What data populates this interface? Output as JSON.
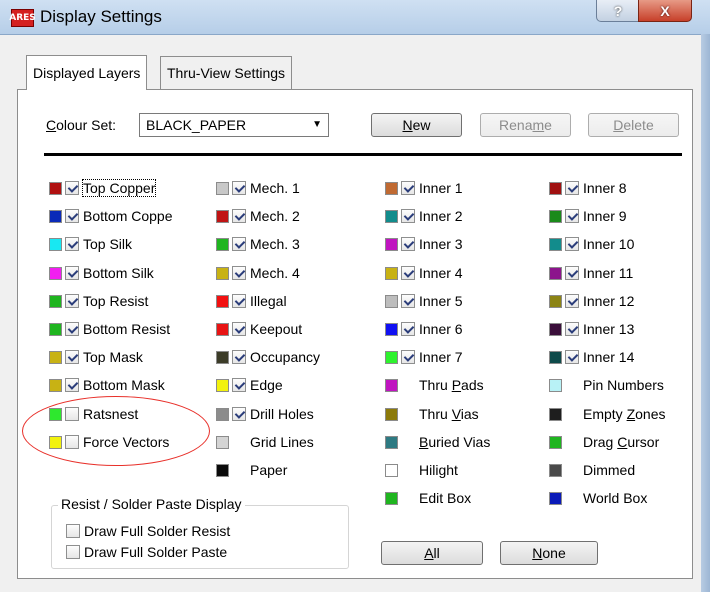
{
  "window": {
    "title": "Display Settings",
    "logo_text": "ARES",
    "help_label": "?",
    "close_label": "X"
  },
  "tabs": [
    {
      "label": "Displayed Layers",
      "active": true
    },
    {
      "label": "Thru-View Settings",
      "active": false
    }
  ],
  "colour_set": {
    "label_prefix": "C",
    "label_rest": "olour Set:",
    "value": "BLACK_PAPER"
  },
  "buttons": {
    "new": {
      "u": "N",
      "rest": "ew",
      "enabled": true
    },
    "rename": {
      "pre": "Rena",
      "u": "m",
      "post": "e",
      "enabled": false
    },
    "delete": {
      "u": "D",
      "rest": "elete",
      "enabled": false
    },
    "all": {
      "u": "A",
      "rest": "ll"
    },
    "none": {
      "u": "N",
      "rest": "one"
    }
  },
  "layers": {
    "col1": [
      {
        "label": "Top Copper",
        "color": "#b01010",
        "checkbox": true,
        "checked": true
      },
      {
        "label": "Bottom Coppe",
        "color": "#0a2ab8",
        "checkbox": true,
        "checked": true
      },
      {
        "label": "Top Silk",
        "color": "#18e8f2",
        "checkbox": true,
        "checked": true
      },
      {
        "label": "Bottom Silk",
        "color": "#f21ef0",
        "checkbox": true,
        "checked": true
      },
      {
        "label": "Top Resist",
        "color": "#1fb51f",
        "checkbox": true,
        "checked": true
      },
      {
        "label": "Bottom Resist",
        "color": "#1fb51f",
        "checkbox": true,
        "checked": true
      },
      {
        "label": "Top Mask",
        "color": "#c8b214",
        "checkbox": true,
        "checked": true
      },
      {
        "label": "Bottom Mask",
        "color": "#c8b214",
        "checkbox": true,
        "checked": true
      },
      {
        "label": "Ratsnest",
        "color": "#2ee82e",
        "checkbox": true,
        "checked": false
      },
      {
        "label": "Force Vectors",
        "color": "#f2f20e",
        "checkbox": true,
        "checked": false
      }
    ],
    "col2": [
      {
        "label": "Mech. 1",
        "color": "#c8c8c8",
        "checkbox": true,
        "checked": true
      },
      {
        "label": "Mech. 2",
        "color": "#c01414",
        "checkbox": true,
        "checked": true
      },
      {
        "label": "Mech. 3",
        "color": "#1fb51f",
        "checkbox": true,
        "checked": true
      },
      {
        "label": "Mech. 4",
        "color": "#c8b214",
        "checkbox": true,
        "checked": true
      },
      {
        "label": "Illegal",
        "color": "#f21010",
        "checkbox": true,
        "checked": true
      },
      {
        "label": "Keepout",
        "color": "#e81414",
        "checkbox": true,
        "checked": true
      },
      {
        "label": "Occupancy",
        "color": "#3c3c28",
        "checkbox": true,
        "checked": true
      },
      {
        "label": "Edge",
        "color": "#f2f20e",
        "checkbox": true,
        "checked": true
      },
      {
        "label": "Drill Holes",
        "color": "#8c8c8c",
        "checkbox": true,
        "checked": true
      },
      {
        "label": "Grid Lines",
        "color": "#d4d4d4",
        "checkbox": false,
        "checked": false
      },
      {
        "label": "Paper",
        "color": "#0a0a0a",
        "checkbox": false,
        "checked": false
      }
    ],
    "col3": [
      {
        "label": "Inner 1",
        "color": "#c06a32",
        "checkbox": true,
        "checked": true
      },
      {
        "label": "Inner 2",
        "color": "#128c8c",
        "checkbox": true,
        "checked": true
      },
      {
        "label": "Inner 3",
        "color": "#c014c0",
        "checkbox": true,
        "checked": true
      },
      {
        "label": "Inner 4",
        "color": "#c8b214",
        "checkbox": true,
        "checked": true
      },
      {
        "label": "Inner 5",
        "color": "#bdbdbd",
        "checkbox": true,
        "checked": true
      },
      {
        "label": "Inner 6",
        "color": "#1010f2",
        "checkbox": true,
        "checked": true
      },
      {
        "label": "Inner 7",
        "color": "#2ef22e",
        "checkbox": true,
        "checked": true
      },
      {
        "label": "Thru Pads",
        "color": "#c014c0",
        "checkbox": false,
        "checked": false,
        "underline": "P"
      },
      {
        "label": "Thru Vias",
        "color": "#8c7a0a",
        "checkbox": false,
        "checked": false,
        "underline": "V"
      },
      {
        "label": "Buried Vias",
        "color": "#2e7a82",
        "checkbox": false,
        "checked": false,
        "underline": "B"
      },
      {
        "label": "Hilight",
        "color": "#ffffff",
        "checkbox": false,
        "checked": false
      },
      {
        "label": "Edit Box",
        "color": "#1fb51f",
        "checkbox": false,
        "checked": false
      }
    ],
    "col4": [
      {
        "label": "Inner 8",
        "color": "#a01010",
        "checkbox": true,
        "checked": true
      },
      {
        "label": "Inner 9",
        "color": "#1a8a1a",
        "checkbox": true,
        "checked": true
      },
      {
        "label": "Inner 10",
        "color": "#128c8c",
        "checkbox": true,
        "checked": true
      },
      {
        "label": "Inner 11",
        "color": "#8c148c",
        "checkbox": true,
        "checked": true
      },
      {
        "label": "Inner 12",
        "color": "#8c8414",
        "checkbox": true,
        "checked": true
      },
      {
        "label": "Inner 13",
        "color": "#3a0e3a",
        "checkbox": true,
        "checked": true
      },
      {
        "label": "Inner 14",
        "color": "#0e4a4a",
        "checkbox": true,
        "checked": true
      },
      {
        "label": "Pin Numbers",
        "color": "#b8f2f6",
        "checkbox": false,
        "checked": false
      },
      {
        "label": "Empty Zones",
        "color": "#1e1e1e",
        "checkbox": false,
        "checked": false,
        "underline": "Z"
      },
      {
        "label": "Drag Cursor",
        "color": "#1fb51f",
        "checkbox": false,
        "checked": false,
        "underline": "C"
      },
      {
        "label": "Dimmed",
        "color": "#4a4a4a",
        "checkbox": false,
        "checked": false
      },
      {
        "label": "World Box",
        "color": "#0a1ab8",
        "checkbox": false,
        "checked": false
      }
    ]
  },
  "resist_group": {
    "title": "Resist / Solder Paste Display",
    "options": [
      {
        "label": "Draw Full Solder Resist",
        "checked": false
      },
      {
        "label": "Draw Full Solder Paste",
        "checked": false
      }
    ]
  },
  "annotation_color": "#e8302a"
}
